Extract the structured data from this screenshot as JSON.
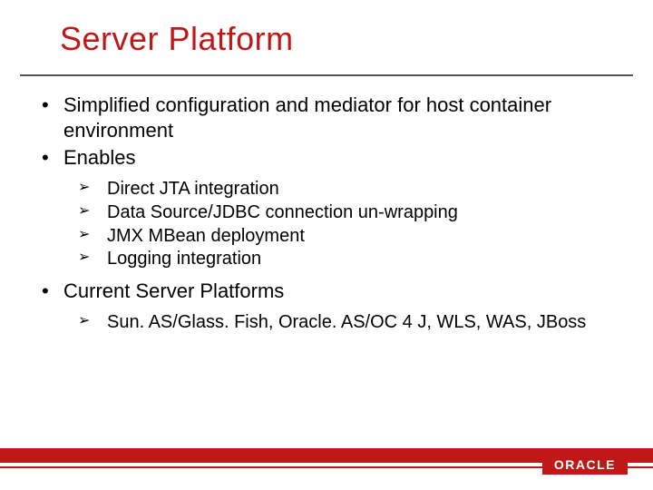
{
  "title": "Server Platform",
  "bullets": {
    "b0": "Simplified configuration and mediator for host container environment",
    "b1": "Enables",
    "b1_sub": {
      "s0": "Direct JTA integration",
      "s1": "Data Source/JDBC connection un-wrapping",
      "s2": "JMX MBean deployment",
      "s3": "Logging integration"
    },
    "b2": "Current Server Platforms",
    "b2_sub": {
      "s0": "Sun. AS/Glass. Fish, Oracle. AS/OC 4 J, WLS, WAS, JBoss"
    }
  },
  "footer": {
    "logo_text": "ORACLE"
  },
  "colors": {
    "accent": "#c01818"
  }
}
